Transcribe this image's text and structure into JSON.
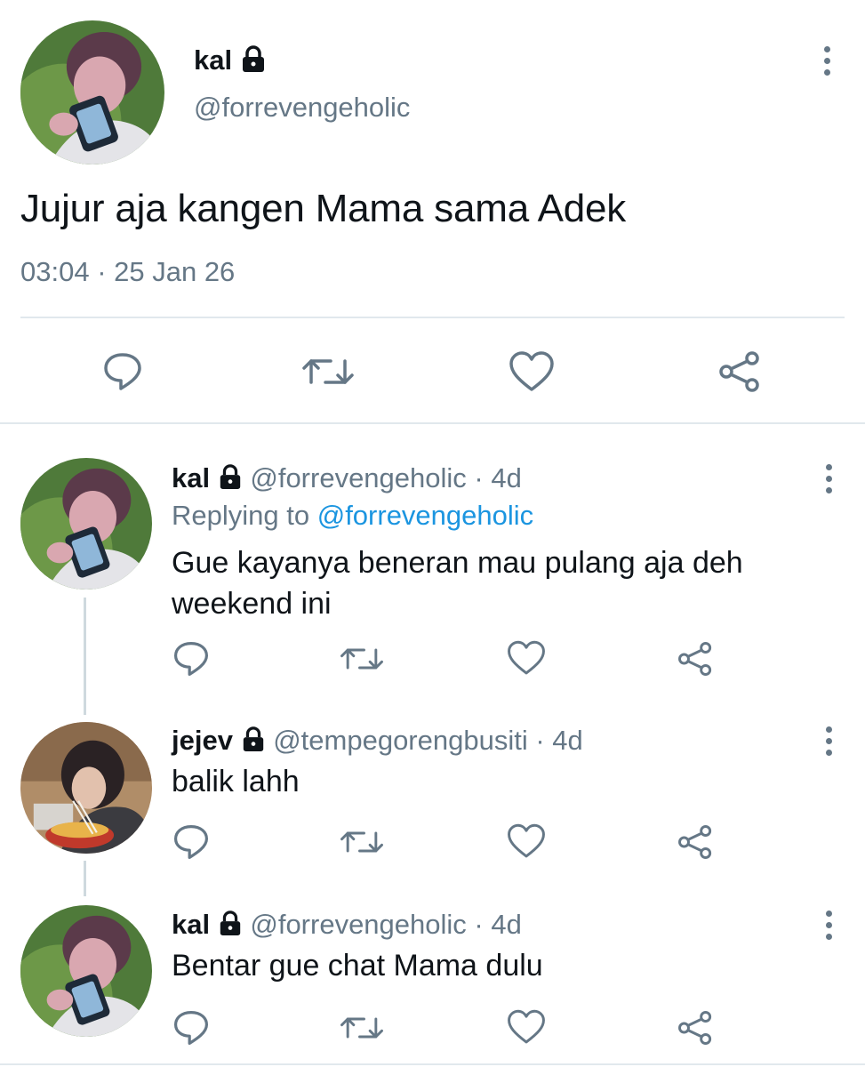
{
  "main_tweet": {
    "name": "kal",
    "handle": "@forrevengeholic",
    "text": "Jujur aja kangen Mama sama Adek",
    "timestamp": "03:04 · 25 Jan 26"
  },
  "replies": [
    {
      "name": "kal",
      "handle": "@forrevengeholic",
      "age": "· 4d",
      "replying_label": "Replying to",
      "replying_to": "@forrevengeholic",
      "text_line1": "Gue kayanya beneran mau pulang aja deh",
      "text_line2": "weekend ini"
    },
    {
      "name": "jejev",
      "handle": "@tempegorengbusiti",
      "age": "· 4d",
      "text": "balik lahh"
    },
    {
      "name": "kal",
      "handle": "@forrevengeholic",
      "age": "· 4d",
      "text": "Bentar gue chat Mama dulu"
    }
  ],
  "icons": {
    "action_set": [
      "reply-icon",
      "retweet-icon",
      "like-icon",
      "share-icon"
    ],
    "menu": "more-options-icon",
    "protected": "lock-icon"
  },
  "colors": {
    "text": "#0f1419",
    "secondary": "#657786",
    "link": "#1b95e0",
    "divider": "#e1e8ed"
  }
}
